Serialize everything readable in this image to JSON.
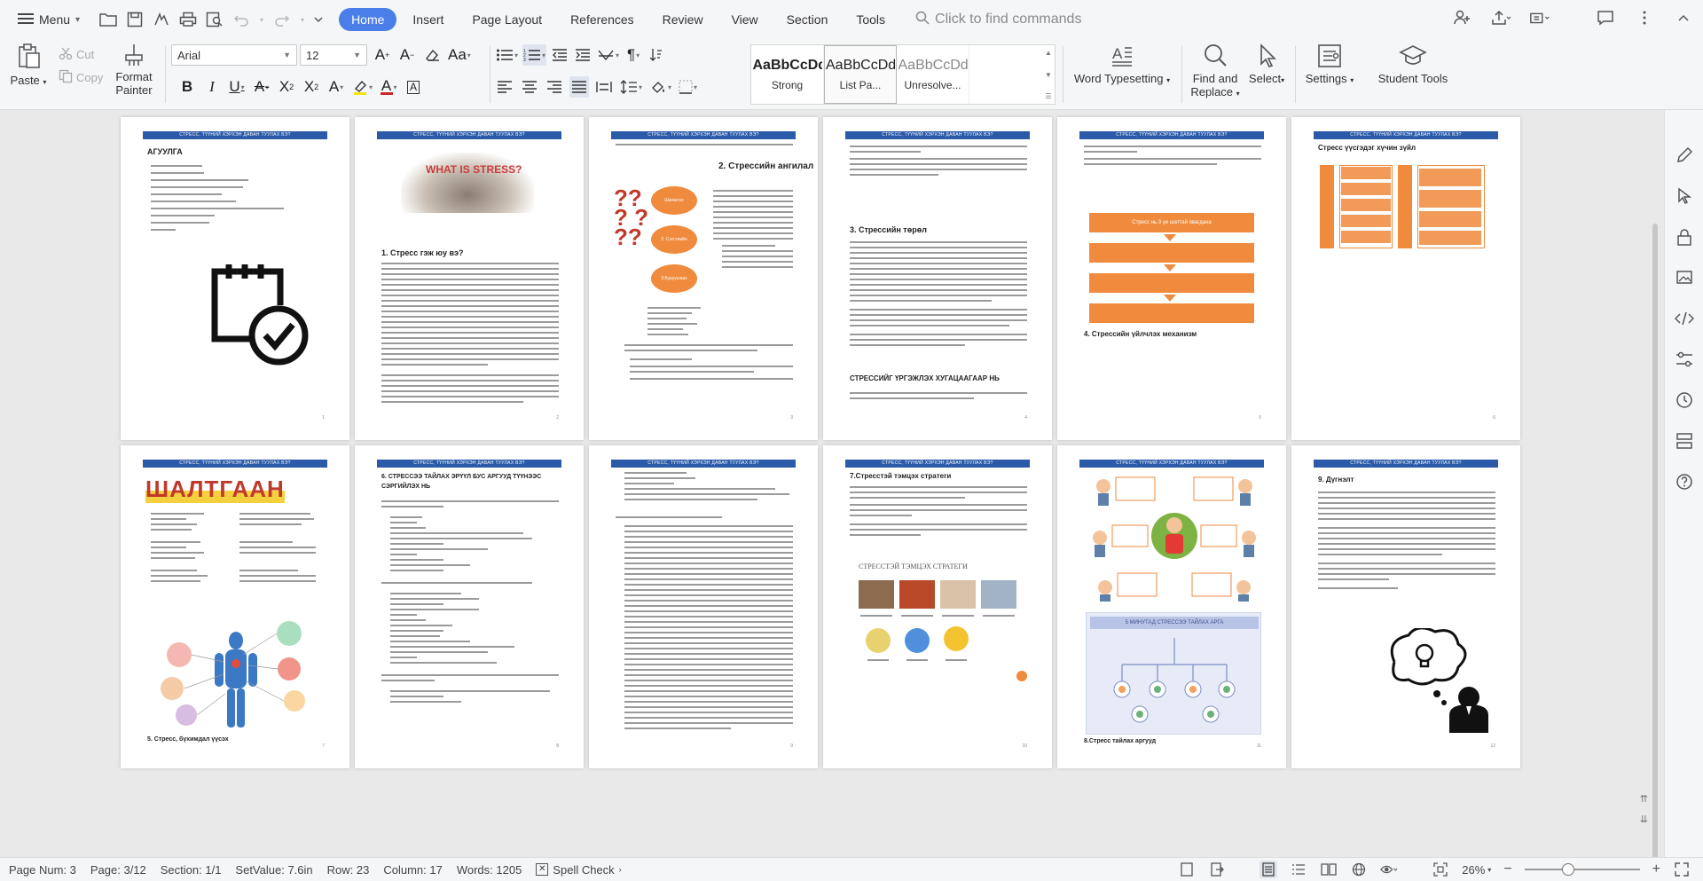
{
  "toolbar": {
    "menu_label": "Menu",
    "tabs": [
      "Home",
      "Insert",
      "Page Layout",
      "References",
      "Review",
      "View",
      "Section",
      "Tools"
    ],
    "active_tab": "Home",
    "find_placeholder": "Click to find commands"
  },
  "ribbon": {
    "paste": "Paste",
    "cut": "Cut",
    "copy": "Copy",
    "format_painter_1": "Format",
    "format_painter_2": "Painter",
    "font_name": "Arial",
    "font_size": "12",
    "styles": [
      {
        "sample": "AaBbCcDd",
        "name": "Strong"
      },
      {
        "sample": "AaBbCcDd",
        "name": "List Pa..."
      },
      {
        "sample": "AaBbCcDd",
        "name": "Unresolve..."
      }
    ],
    "word_typesetting": "Word Typesetting",
    "find_replace_1": "Find and",
    "find_replace_2": "Replace",
    "select": "Select",
    "settings": "Settings",
    "student_tools": "Student Tools"
  },
  "document": {
    "header_text": "СТРЕСС, ТҮҮНИЙ ХЭРХЭН ДАВАН ТУУЛАХ ВЭ?",
    "pages": [
      {
        "title": "АГУУЛГА"
      },
      {
        "title": "1. Стресс гэж юу вэ?",
        "image_text": "WHAT IS STRESS?"
      },
      {
        "title": "2. Стрессийн ангилал",
        "bubbles": [
          "Шинжлэх",
          "2. Сэтгэлийн",
          "3.Буруушаах"
        ]
      },
      {
        "title": "3. Стрессийн төрөл",
        "subtitle": "СТРЕССИЙГ ҮРГЭЖЛЭХ ХУГАЦААГААР НЬ"
      },
      {
        "title": "4. Стрессийн үйлчлэх механизм",
        "flow": "Стресс нь 3 үе шаттай явагдана"
      },
      {
        "title": "Стресс үүсгэдэг хүчин зүйл"
      },
      {
        "title": "ШАЛТГААН",
        "caption": "5. Стресс, бүхимдал үүсэх"
      },
      {
        "title": "6. СТРЕССЭЭ ТАЙЛАХ ЭРҮҮЛ БУС АРГУУД ТҮҮНЭЭС СЭРГИЙЛЭХ НЬ"
      },
      {
        "title": ""
      },
      {
        "title": "7.Стресстэй тэмцэх стратеги",
        "subtitle": "СТРЕССТЭЙ ТЭМЦЭХ СТРАТЕГИ"
      },
      {
        "title": "",
        "banner": "5 МИНУТАД СТРЕССЭЭ ТАЙЛАХ АРГА",
        "caption": "8.Стресс тайлах аргууд"
      },
      {
        "title": "9. Дүгнэлт"
      }
    ]
  },
  "status": {
    "page_num": "Page Num: 3",
    "page": "Page: 3/12",
    "section": "Section: 1/1",
    "setvalue": "SetValue: 7.6in",
    "row": "Row: 23",
    "column": "Column: 17",
    "words": "Words: 1205",
    "spell_check": "Spell Check",
    "zoom": "26%"
  }
}
